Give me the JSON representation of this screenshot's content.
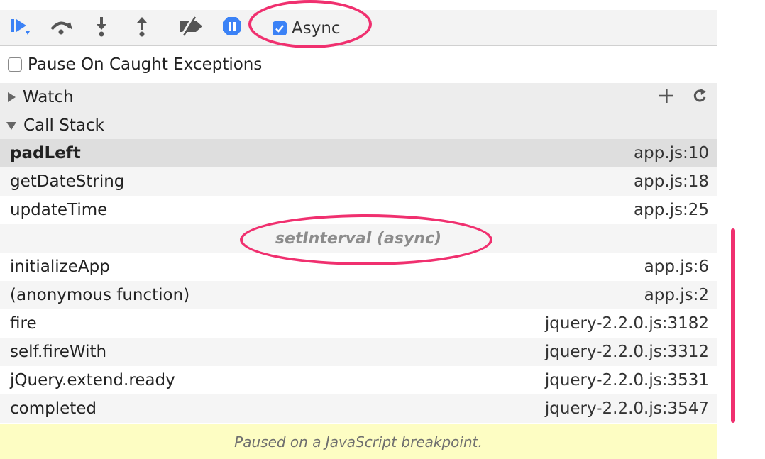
{
  "toolbar": {
    "buttons": [
      {
        "name": "resume-icon"
      },
      {
        "name": "step-over-icon"
      },
      {
        "name": "step-into-icon"
      },
      {
        "name": "step-out-icon"
      },
      {
        "name": "deactivate-breakpoints-icon"
      },
      {
        "name": "pause-on-exceptions-icon"
      }
    ],
    "async_label": "Async",
    "async_checked": true,
    "accent_color": "#3b82f6"
  },
  "pause_on_caught": {
    "label": "Pause On Caught Exceptions",
    "checked": false
  },
  "watch": {
    "title": "Watch",
    "add_icon": "plus-icon",
    "refresh_icon": "refresh-icon"
  },
  "call_stack": {
    "title": "Call Stack",
    "frames_sync": [
      {
        "fn": "padLeft",
        "loc": "app.js:10"
      },
      {
        "fn": "getDateString",
        "loc": "app.js:18"
      },
      {
        "fn": "updateTime",
        "loc": "app.js:25"
      }
    ],
    "async_separator": "setInterval (async)",
    "frames_async": [
      {
        "fn": "initializeApp",
        "loc": "app.js:6"
      },
      {
        "fn": "(anonymous function)",
        "loc": "app.js:2"
      },
      {
        "fn": "fire",
        "loc": "jquery-2.2.0.js:3182"
      },
      {
        "fn": "self.fireWith",
        "loc": "jquery-2.2.0.js:3312"
      },
      {
        "fn": "jQuery.extend.ready",
        "loc": "jquery-2.2.0.js:3531"
      },
      {
        "fn": "completed",
        "loc": "jquery-2.2.0.js:3547"
      }
    ]
  },
  "status": {
    "message": "Paused on a JavaScript breakpoint."
  },
  "annotation_color": "#f0306f"
}
